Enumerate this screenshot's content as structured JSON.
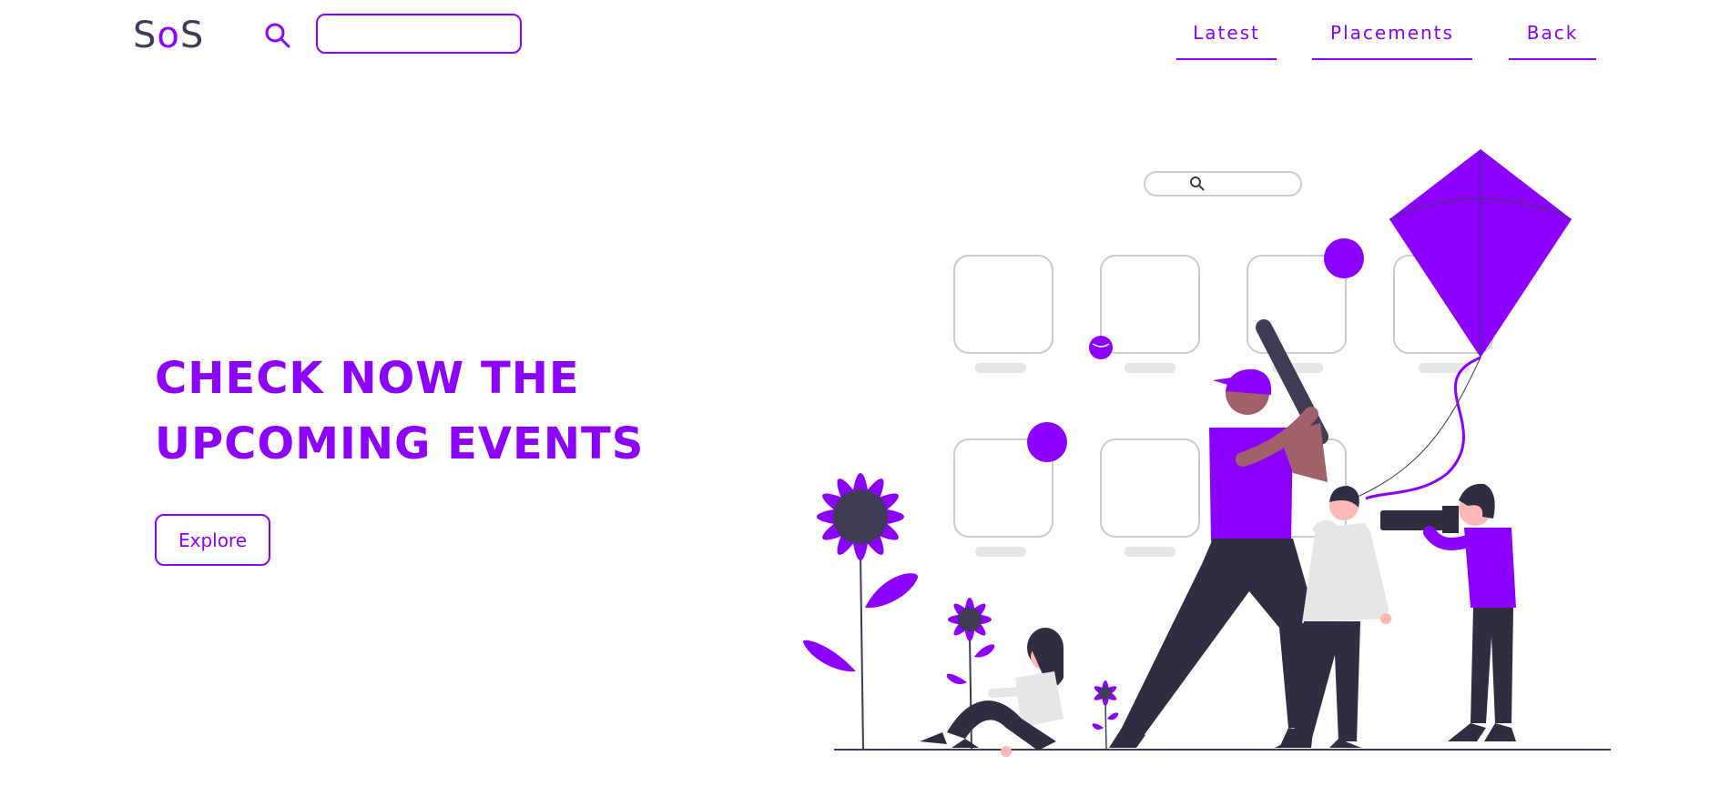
{
  "header": {
    "logo": {
      "part1": "S",
      "part2": "o",
      "part3": "S"
    },
    "search": {
      "placeholder": "",
      "value": ""
    },
    "nav": [
      {
        "label": "Latest"
      },
      {
        "label": "Placements"
      },
      {
        "label": "Back"
      }
    ]
  },
  "hero": {
    "title_line1": "CHECK NOW THE",
    "title_line2": "UPCOMING EVENTS",
    "cta_label": "Explore"
  },
  "colors": {
    "accent": "#8c00ff",
    "dark": "#3f3d56",
    "outline": "#cccccc",
    "skin_dark": "#a0616a",
    "skin_light": "#ffb8b8",
    "pants": "#2f2e41"
  }
}
